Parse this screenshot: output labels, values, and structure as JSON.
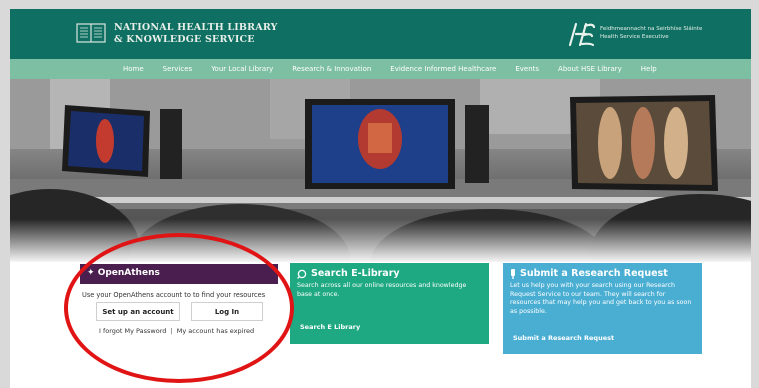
{
  "header": {
    "logo_line1": "NATIONAL HEALTH LIBRARY",
    "logo_line2": "& KNOWLEDGE SERVICE",
    "hse_line1": "Feidhmeannacht na Seirbhíse Sláinte",
    "hse_line2": "Health Service Executive"
  },
  "nav": {
    "items": [
      "Home",
      "Services",
      "Your Local Library",
      "Research & Innovation",
      "Evidence Informed Healthcare",
      "Events",
      "About HSE Library",
      "Help"
    ]
  },
  "openathens": {
    "title": "OpenAthens",
    "description": "Use your OpenAthens account to to find your resources",
    "setup_label": "Set up an account",
    "login_label": "Log In",
    "forgot_label": "I forgot My Password",
    "expired_label": "My account has expired"
  },
  "search_elibrary": {
    "title": "Search E-Library",
    "body": "Search across all our online resources and knowledge base at once.",
    "link": "Search E Library"
  },
  "research_request": {
    "title": "Submit a Research Request",
    "body": "Let us help you with your search using our Research Request Service to our team. They will search for resources that may help you and get back to you as soon as possible.",
    "link": "Submit a Research Request"
  },
  "colors": {
    "header": "#0f6f62",
    "nav": "#7dbfa3",
    "openathens": "#4a1f4f",
    "green_panel": "#1fa982",
    "blue_panel": "#4aaed3",
    "annotation": "#e01414"
  },
  "icons": [
    "book-logo-icon",
    "hse-logo-icon",
    "openathens-icon",
    "search-icon",
    "research-icon"
  ]
}
